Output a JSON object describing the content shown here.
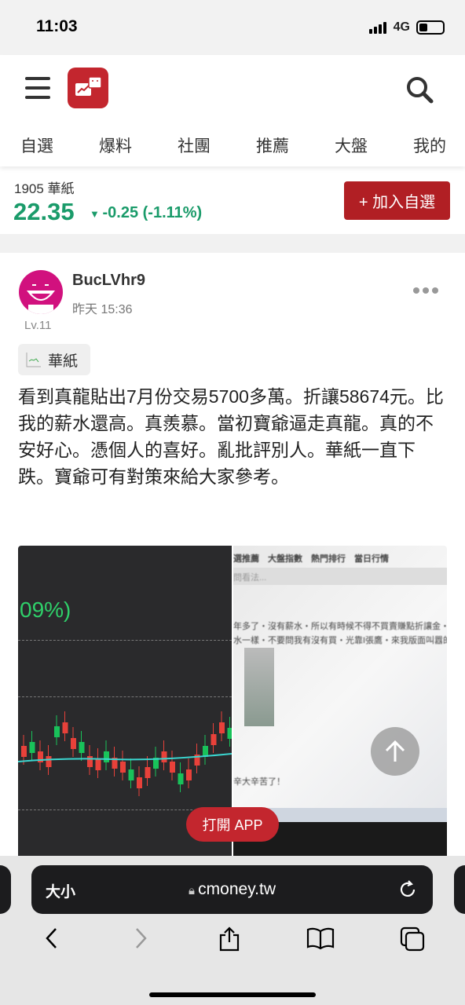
{
  "status_bar": {
    "time": "11:03",
    "network": "4G"
  },
  "header": {
    "nav_tabs": [
      "自選",
      "爆料",
      "社團",
      "推薦",
      "大盤",
      "我的"
    ]
  },
  "stock": {
    "code_name": "1905 華紙",
    "price": "22.35",
    "change": "-0.25 (-1.11%)",
    "direction": "down",
    "add_button": "+ 加入自選",
    "up_color": "#1a9b6a",
    "accent": "#b11f24"
  },
  "post": {
    "username": "BucLVhr9",
    "time": "昨天 15:36",
    "level": "Lv.11",
    "tag": "華紙",
    "content": "看到真龍貼出7月份交易5700多萬。折讓58674元。比我的薪水還高。真羨慕。當初寶爺逼走真龍。真的不安好心。憑個人的喜好。亂批評別人。華紙一直下跌。寶爺可有對策來給大家參考。",
    "image1": {
      "percent_text": "09%)"
    },
    "image2": {
      "menu_text": "選推薦　大盤指數　熱門排行　當日行情",
      "input_text": "問看法...",
      "line1": "年多了・沒有薪水・所以有時候不得不買賣賺點折讓金・",
      "line2": "水一樣・不要問我有沒有買・光靠I張鷹・來我版面叫囂的",
      "line3": "辛大辛苦了！"
    }
  },
  "open_app": "打開 APP",
  "browser": {
    "text_size": "大小",
    "url": "cmoney.tw"
  }
}
